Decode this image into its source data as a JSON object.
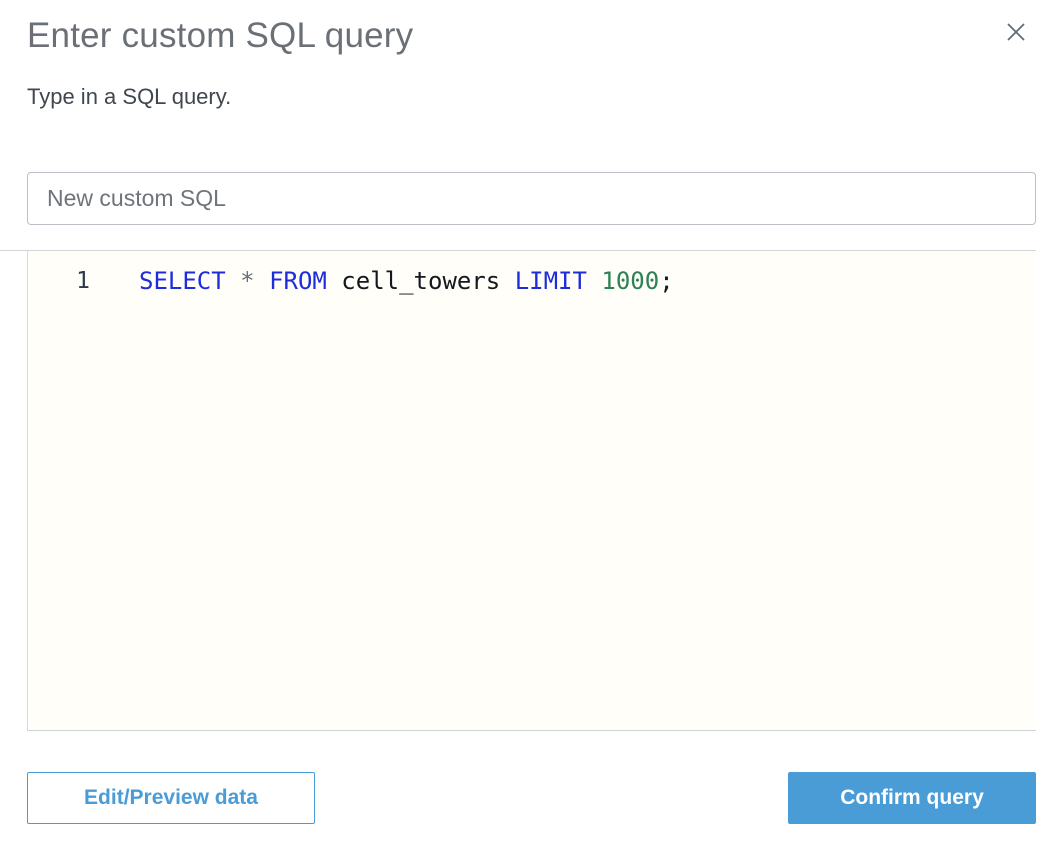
{
  "modal": {
    "title": "Enter custom SQL query",
    "subtitle": "Type in a SQL query."
  },
  "name_input": {
    "value": "New custom SQL"
  },
  "editor": {
    "line_number": "1",
    "code_text": "SELECT * FROM cell_towers LIMIT 1000;",
    "tokens": [
      {
        "text": "SELECT",
        "type": "keyword"
      },
      {
        "text": " ",
        "type": "plain"
      },
      {
        "text": "*",
        "type": "operator"
      },
      {
        "text": " ",
        "type": "plain"
      },
      {
        "text": "FROM",
        "type": "keyword"
      },
      {
        "text": " cell_towers ",
        "type": "plain"
      },
      {
        "text": "LIMIT",
        "type": "keyword"
      },
      {
        "text": " ",
        "type": "plain"
      },
      {
        "text": "1000",
        "type": "number"
      },
      {
        "text": ";",
        "type": "plain"
      }
    ],
    "syntax_colors": {
      "keyword": "#1f2cdb",
      "operator": "#67717d",
      "plain": "#14191f",
      "number": "#2e8153"
    }
  },
  "footer": {
    "edit_preview_label": "Edit/Preview data",
    "confirm_label": "Confirm query"
  },
  "colors": {
    "accent_blue": "#4a9cd6",
    "editor_background": "#fffef9",
    "title_gray": "#6b7077",
    "border_gray": "#d2d6d9"
  }
}
